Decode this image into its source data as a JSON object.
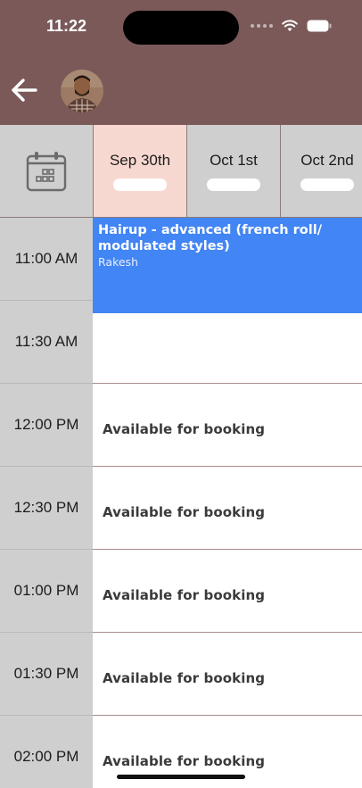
{
  "status_bar": {
    "time": "11:22"
  },
  "header": {
    "back_icon": "arrow-left-icon",
    "avatar_alt": "avatar"
  },
  "dates": [
    {
      "label": "Sep 30th",
      "selected": true
    },
    {
      "label": "Oct 1st",
      "selected": false
    },
    {
      "label": "Oct 2nd",
      "selected": false
    }
  ],
  "times": [
    "11:00 AM",
    "11:30 AM",
    "12:00 PM",
    "12:30 PM",
    "01:00 PM",
    "01:30 PM",
    "02:00 PM"
  ],
  "appointment": {
    "title": "Hairup - advanced (french roll/ modulated styles)",
    "staff": "Rakesh"
  },
  "slots": [
    "",
    "",
    "Available for booking",
    "Available for booking",
    "Available for booking",
    "Available for booking",
    "Available for booking"
  ],
  "colors": {
    "header_bg": "#7b5959",
    "selected_date_bg": "#f7d8d0",
    "appointment_bg": "#4285f4",
    "time_column_bg": "#cfcfcf"
  }
}
